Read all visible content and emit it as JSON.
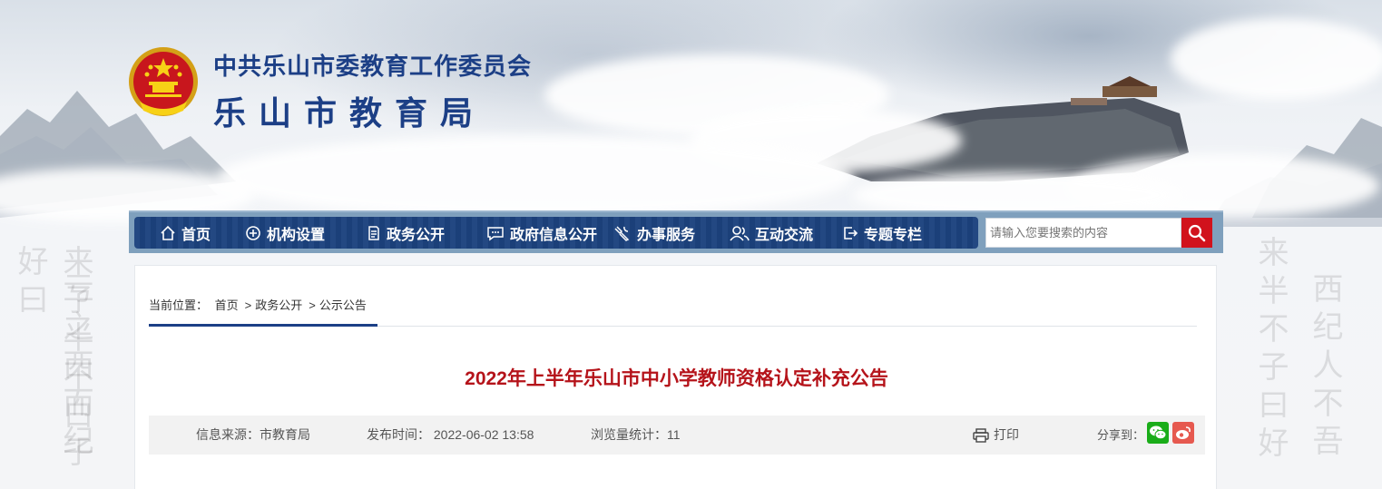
{
  "site": {
    "org_name": "中共乐山市委教育工作委员会",
    "bureau_name": "乐山市教育局"
  },
  "nav": {
    "items": [
      {
        "label": "首页",
        "icon": "home-icon"
      },
      {
        "label": "机构设置",
        "icon": "plus-circle-icon"
      },
      {
        "label": "政务公开",
        "icon": "document-icon"
      },
      {
        "label": "政府信息公开",
        "icon": "message-icon"
      },
      {
        "label": "办事服务",
        "icon": "tools-icon"
      },
      {
        "label": "互动交流",
        "icon": "users-icon"
      },
      {
        "label": "专题专栏",
        "icon": "exit-icon"
      }
    ],
    "search_placeholder": "请输入您要搜索的内容"
  },
  "breadcrumb": {
    "prefix": "当前位置：",
    "items": [
      "首页",
      "政务公开",
      "公示公告"
    ],
    "separator": ">"
  },
  "article": {
    "title": "2022年上半年乐山市中小学教师资格认定补充公告",
    "source": "信息来源：市教育局",
    "publish_time": "发布时间： 2022-06-02 13:58",
    "views": "浏览量统计：11",
    "print_label": "打印",
    "share_label": "分享到："
  },
  "colors": {
    "brand_blue": "#1c3f86",
    "nav_blue": "#1c427e",
    "title_red": "#b5131a",
    "search_red": "#d1121c",
    "wechat_green": "#1aad19",
    "weibo_red": "#e6594f"
  }
}
